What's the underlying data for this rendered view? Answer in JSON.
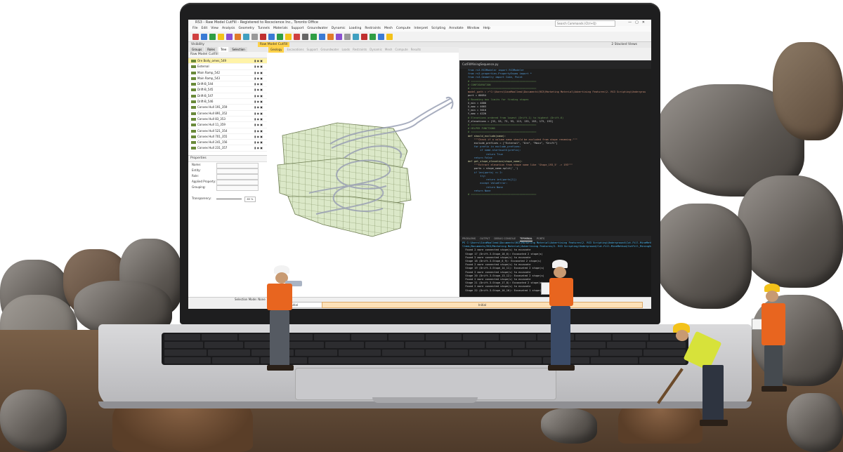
{
  "app": {
    "window_title": "RS3 - Raw Model CutFill - Registered to Rocscience Inc., Toronto Office",
    "search_placeholder": "Search Commands (Ctrl+Q)",
    "menu": [
      "File",
      "Edit",
      "View",
      "Analysis",
      "Geometry",
      "Tunnels",
      "Materials",
      "Support",
      "Groundwater",
      "Dynamic",
      "Loading",
      "Restraints",
      "Mesh",
      "Compute",
      "Interpret",
      "Scripting",
      "Annotate",
      "Window",
      "Help"
    ],
    "document_tab": "Raw Model CutFill",
    "views_label": "2 Stacked Views",
    "visibility_label": "Visibility",
    "left_tabs": [
      "Groups",
      "Roles",
      "Tree",
      "Selection"
    ],
    "active_left_tab": "Tree",
    "tree_root": "Raw Model CutFill",
    "tree_items": [
      "Ore Body_omes_549",
      "External",
      "Main Ramp_542",
      "Main Ramp_543",
      "Drift-B_544",
      "Drift-B_545",
      "Drift-B_547",
      "Drift-B_546",
      "Convex Hull 191_359",
      "Convex Hull 891_352",
      "Convex Hull 83_353",
      "Convex Hull 11_359",
      "Convex Hull 521_354",
      "Convex Hull 701_355",
      "Convex Hull 241_156",
      "Convex Hull 231_357"
    ],
    "properties_title": "Properties",
    "properties": [
      {
        "label": "Name:",
        "value": ""
      },
      {
        "label": "Entity:",
        "value": ""
      },
      {
        "label": "Role:",
        "value": ""
      },
      {
        "label": "Applied Property:",
        "value": ""
      },
      {
        "label": "Grouping:",
        "value": ""
      }
    ],
    "transparency_label": "Transparency:",
    "transparency_value": "85 %",
    "stage_tabs": [
      "Geology",
      "Excavations",
      "Support",
      "Groundwater",
      "Loads",
      "Restraints",
      "Dynamic",
      "Mesh",
      "Compute",
      "Results"
    ],
    "active_stage_tab": "Geology",
    "selection_mode_label": "Selection Mode: None",
    "stage_select_value": "Initial",
    "stage_bar_value": "Initial"
  },
  "editor": {
    "tab_label": "CutFillMiningSequence.py",
    "code_lines": [
      {
        "cls": "kw",
        "text": "from rs3.RS3Modeler import RS3Modeler"
      },
      {
        "cls": "kw",
        "text": "from rs3.properties.PropertyEnums import *"
      },
      {
        "cls": "kw",
        "text": "from rs3.Geometry import Cube, Point"
      },
      {
        "cls": "",
        "text": ""
      },
      {
        "cls": "cm",
        "text": "# ==========================================="
      },
      {
        "cls": "cm",
        "text": "# CONFIGURATION"
      },
      {
        "cls": "cm",
        "text": "# ==========================================="
      },
      {
        "cls": "st",
        "text": "model_path = r\"C:\\Users\\SinaMoallemi\\Documents\\RS3\\Marketing Material\\Advertising Features\\2- RS3 Scripting\\Undergrou"
      },
      {
        "cls": "",
        "text": "port = 60054"
      },
      {
        "cls": "",
        "text": ""
      },
      {
        "cls": "cm",
        "text": "# Bounding box limits for finding stopes"
      },
      {
        "cls": "",
        "text": "X_min = 4000"
      },
      {
        "cls": "",
        "text": "X_max = 4003"
      },
      {
        "cls": "",
        "text": "Y_min = 3010"
      },
      {
        "cls": "",
        "text": "Y_max = 4220"
      },
      {
        "cls": "",
        "text": ""
      },
      {
        "cls": "cm",
        "text": "# Elevations ordered from lowest (Drift-1) to highest (Drift-6)"
      },
      {
        "cls": "",
        "text": "Z_elevations = [33, 53, 73, 93, 113, 133, 153, 173, 193]"
      },
      {
        "cls": "",
        "text": ""
      },
      {
        "cls": "cm",
        "text": "# ==========================================="
      },
      {
        "cls": "cm",
        "text": "# HELPER FUNCTIONS"
      },
      {
        "cls": "cm",
        "text": "# ==========================================="
      },
      {
        "cls": "fn",
        "text": "def should_exclude(name):"
      },
      {
        "cls": "st",
        "text": "    \"\"\"Check if a volume name should be excluded from stope renaming.\"\"\""
      },
      {
        "cls": "",
        "text": "    exclude_prefixes = [\"External\", \"Ore\", \"Main\", \"Drift\"]"
      },
      {
        "cls": "kw",
        "text": "    for prefix in exclude_prefixes:"
      },
      {
        "cls": "kw",
        "text": "        if name.startswith(prefix):"
      },
      {
        "cls": "kw",
        "text": "            return True"
      },
      {
        "cls": "kw",
        "text": "    return False"
      },
      {
        "cls": "",
        "text": ""
      },
      {
        "cls": "fn",
        "text": "def get_stope_elevation(stope_name):"
      },
      {
        "cls": "st",
        "text": "    \"\"\"Extract elevation from stope name like 'Stope_193_5' -> 193\"\"\""
      },
      {
        "cls": "",
        "text": "    parts = stope_name.split('_')"
      },
      {
        "cls": "kw",
        "text": "    if len(parts) >= 2:"
      },
      {
        "cls": "kw",
        "text": "        try:"
      },
      {
        "cls": "kw",
        "text": "            return int(parts[1])"
      },
      {
        "cls": "kw",
        "text": "        except ValueError:"
      },
      {
        "cls": "kw",
        "text": "            return None"
      },
      {
        "cls": "kw",
        "text": "    return None"
      },
      {
        "cls": "cm",
        "text": "# ==========================================="
      }
    ],
    "terminal_tabs": [
      "PROBLEMS",
      "OUTPUT",
      "DEBUG CONSOLE",
      "TERMINAL",
      "PORTS"
    ],
    "terminal_lines": [
      {
        "cls": "path",
        "text": "PS C:\\Users\\SinaMoallemi\\Documents\\RS3\\Marketing Material\\Advertising Features\\2- RS3 Scripting\\Underground\\Cut-Fill-MineMethod> & C:"
      },
      {
        "cls": "path",
        "text": "llemi/Documents/RS3/Marketing Material/Advertising Features/2- RS3 Scripting/Underground/Cut-Fill-MineMethod/CutFill_MiningSequence"
      },
      {
        "cls": "",
        "text": "  Found 2 more connected stope(s) to excavate"
      },
      {
        "cls": "",
        "text": "  Stage 17 (Drift-3-Stope_18_6): Excavated 2 stope(s)"
      },
      {
        "cls": "",
        "text": "  Found 2 more connected stope(s) to excavate"
      },
      {
        "cls": "",
        "text": "  Stage 18 (Drift-3-Stope_6_9): Excavated 2 stope(s)"
      },
      {
        "cls": "",
        "text": "  Found 2 more connected stope(s) to excavate"
      },
      {
        "cls": "",
        "text": "  Stage 19 (Drift-3-Stope_14_11): Excavated 2 stope(s)"
      },
      {
        "cls": "",
        "text": "  Found 2 more connected stope(s) to excavate"
      },
      {
        "cls": "",
        "text": "  Stage 20 (Drift-3-Stope_13_12): Excavated 2 stope(s)"
      },
      {
        "cls": "",
        "text": "  Found 2 more connected stope(s) to excavate"
      },
      {
        "cls": "",
        "text": "  Stage 21 (Drift-3-Stope_17_8): Excavated 2 stope(s)"
      },
      {
        "cls": "",
        "text": "  Found 2 more connected stope(s) to excavate"
      },
      {
        "cls": "",
        "text": "  Stage 22 (Drift-3-Stope_16_10): Excavated 1 stope(s)"
      }
    ]
  },
  "colors": {
    "accent": "#ffd24a",
    "vest_orange": "#e8651f",
    "vest_yellow": "#d7e23a",
    "helmet_white": "#f2f2f2",
    "helmet_yellow": "#f3c21a",
    "model_green": "#d7e6c4"
  }
}
